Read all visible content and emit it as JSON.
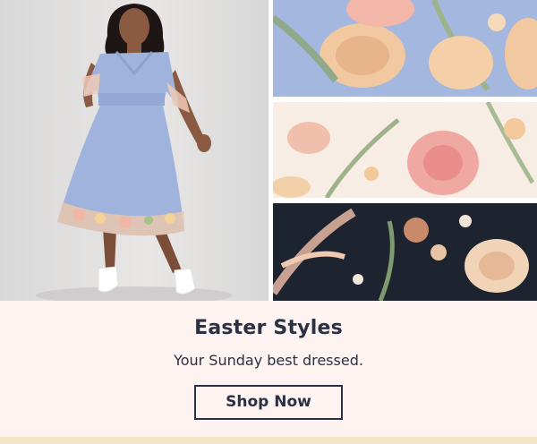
{
  "promo": {
    "headline": "Easter Styles",
    "subheadline": "Your Sunday best dressed.",
    "cta_label": "Shop Now"
  },
  "colors": {
    "background": "#fdf3f1",
    "text": "#2b3143",
    "dress_blue": "#9fb3dc",
    "bottom_bar": "#f5e5c6"
  }
}
